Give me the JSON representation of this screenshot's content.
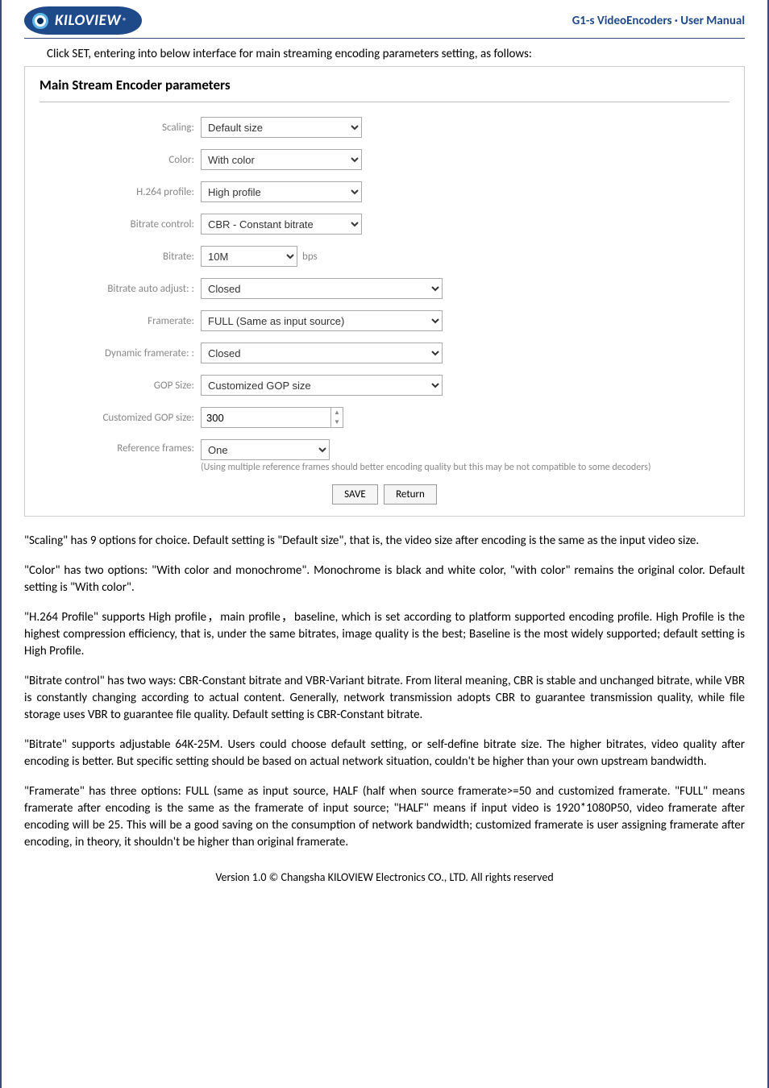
{
  "header": {
    "logo_text": "KILOVIEW",
    "logo_reg": "®",
    "doc_title": "G1-s VideoEncoders · User Manual"
  },
  "intro_text": "Click SET, entering into below interface for main streaming encoding parameters setting, as follows:",
  "panel": {
    "title": "Main Stream Encoder parameters",
    "rows": {
      "scaling": {
        "label": "Scaling:",
        "value": "Default size"
      },
      "color": {
        "label": "Color:",
        "value": "With color"
      },
      "h264_profile": {
        "label": "H.264 profile:",
        "value": "High profile"
      },
      "bitrate_control": {
        "label": "Bitrate control:",
        "value": "CBR - Constant bitrate"
      },
      "bitrate": {
        "label": "Bitrate:",
        "value": "10M",
        "unit": "bps"
      },
      "bitrate_auto_adjust": {
        "label": "Bitrate auto adjust: :",
        "value": "Closed"
      },
      "framerate": {
        "label": "Framerate:",
        "value": "FULL (Same as input source)"
      },
      "dynamic_framerate": {
        "label": "Dynamic framerate: :",
        "value": "Closed"
      },
      "gop_size": {
        "label": "GOP Size:",
        "value": "Customized GOP size"
      },
      "custom_gop": {
        "label": "Customized GOP size:",
        "value": "300"
      },
      "ref_frames": {
        "label": "Reference frames:",
        "value": "One",
        "note": "(Using multiple reference frames should better encoding quality but this may be not compatible to some decoders)"
      }
    },
    "buttons": {
      "save": "SAVE",
      "return": "Return"
    }
  },
  "paragraphs": {
    "p1": "\"Scaling\" has 9 options for choice. Default setting is \"Default size\", that is, the video size after encoding is the same as the input video size.",
    "p2": "\"Color\" has two options: \"With color and monochrome\". Monochrome is black and white color, \"with color\" remains the original color. Default setting is \"With color\".",
    "p3": "\"H.264 Profile\" supports High profile，main profile，baseline, which is set according to platform supported encoding profile. High Profile is the highest compression efficiency, that is, under the same bitrates, image quality is the best; Baseline is the most widely supported; default setting is High Profile.",
    "p4": "\"Bitrate control\" has two ways: CBR-Constant bitrate and VBR-Variant bitrate. From literal meaning, CBR is stable and unchanged bitrate, while VBR is constantly changing according to actual content. Generally, network transmission adopts CBR to guarantee transmission quality, while file storage uses VBR to guarantee file quality. Default setting is CBR-Constant bitrate.",
    "p5": "\"Bitrate\" supports adjustable 64K-25M. Users could choose default setting, or self-define bitrate size. The higher bitrates, video quality after encoding is better. But specific setting should be based on actual network situation, couldn't be higher than your own upstream bandwidth.",
    "p6": "\"Framerate\" has three options: FULL (same as input source, HALF (half when source framerate>=50 and customized framerate. \"FULL\" means framerate after encoding is the same as the framerate of input source; \"HALF\" means if input video is 1920*1080P50, video framerate after encoding will be 25. This will be a good saving on the consumption of network bandwidth; customized framerate is user assigning framerate after encoding, in theory, it shouldn't be higher than original framerate."
  },
  "footer": "Version 1.0 © Changsha KILOVIEW Electronics CO., LTD. All rights reserved"
}
